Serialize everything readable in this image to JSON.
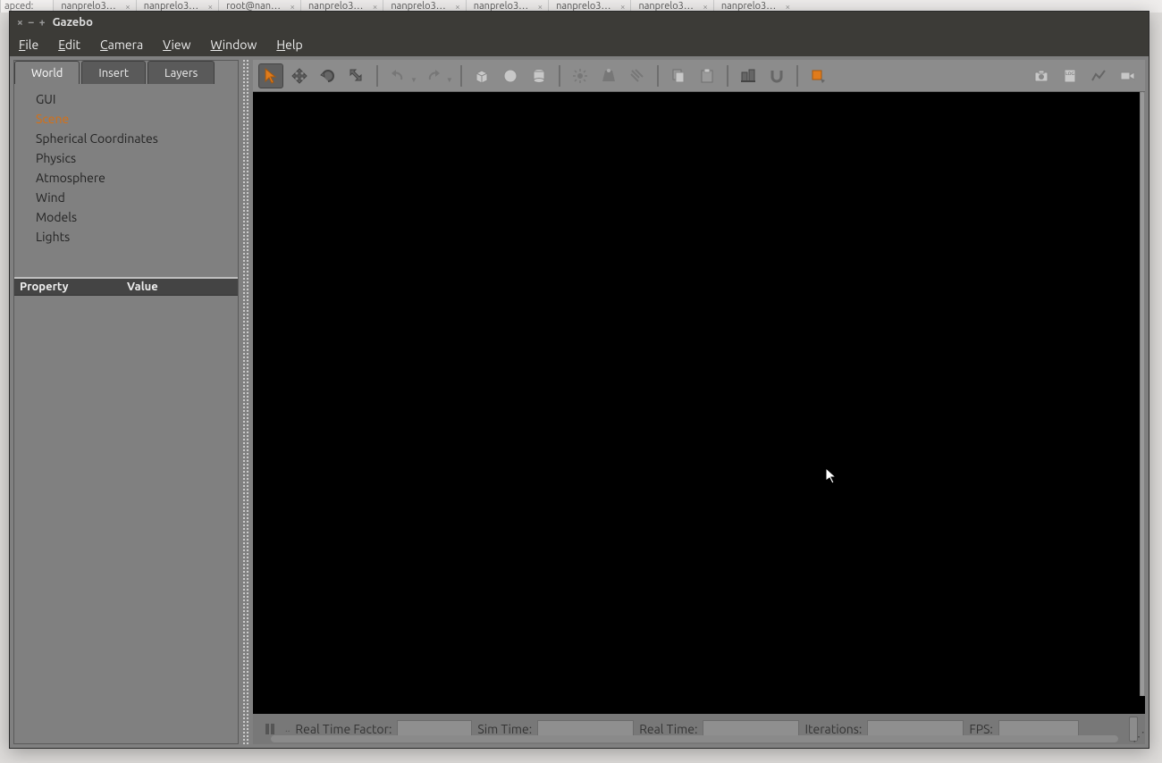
{
  "bg_tabs": [
    "apced:",
    "nanprelo3…",
    "nanprelo3…",
    "root@nan…",
    "nanprelo3…",
    "nanprelo3…",
    "nanprelo3…",
    "nanprelo3…",
    "nanprelo3…",
    "nanprelo3…"
  ],
  "window": {
    "title": "Gazebo",
    "buttons": {
      "close": "×",
      "min": "–",
      "max": "+"
    }
  },
  "menubar": [
    "File",
    "Edit",
    "Camera",
    "View",
    "Window",
    "Help"
  ],
  "left_tabs": [
    "World",
    "Insert",
    "Layers"
  ],
  "left_tabs_active": 0,
  "tree": {
    "items": [
      "GUI",
      "Scene",
      "Spherical Coordinates",
      "Physics",
      "Atmosphere",
      "Wind",
      "Models",
      "Lights"
    ],
    "selected": 1
  },
  "property_panel": {
    "col_property": "Property",
    "col_value": "Value"
  },
  "toolbar_icons": [
    "select-arrow-icon",
    "move-icon",
    "rotate-icon",
    "scale-icon",
    "sep",
    "undo-icon",
    "undo-drop",
    "redo-icon",
    "redo-drop",
    "sep",
    "box-icon",
    "sphere-icon",
    "cylinder-icon",
    "sep",
    "point-light-icon",
    "spot-light-icon",
    "directional-light-icon",
    "sep",
    "copy-icon",
    "paste-icon",
    "sep",
    "align-icon",
    "snap-icon",
    "sep",
    "select-box-icon"
  ],
  "toolbar_right_icons": [
    "screenshot-icon",
    "log-icon",
    "plot-icon",
    "record-icon"
  ],
  "status": {
    "rtf_label": "Real Time Factor:",
    "sim_label": "Sim Time:",
    "real_label": "Real Time:",
    "it_label": "Iterations:",
    "fps_label": "FPS:",
    "rtf_value": "",
    "sim_value": "",
    "real_value": "",
    "it_value": "",
    "fps_value": ""
  }
}
